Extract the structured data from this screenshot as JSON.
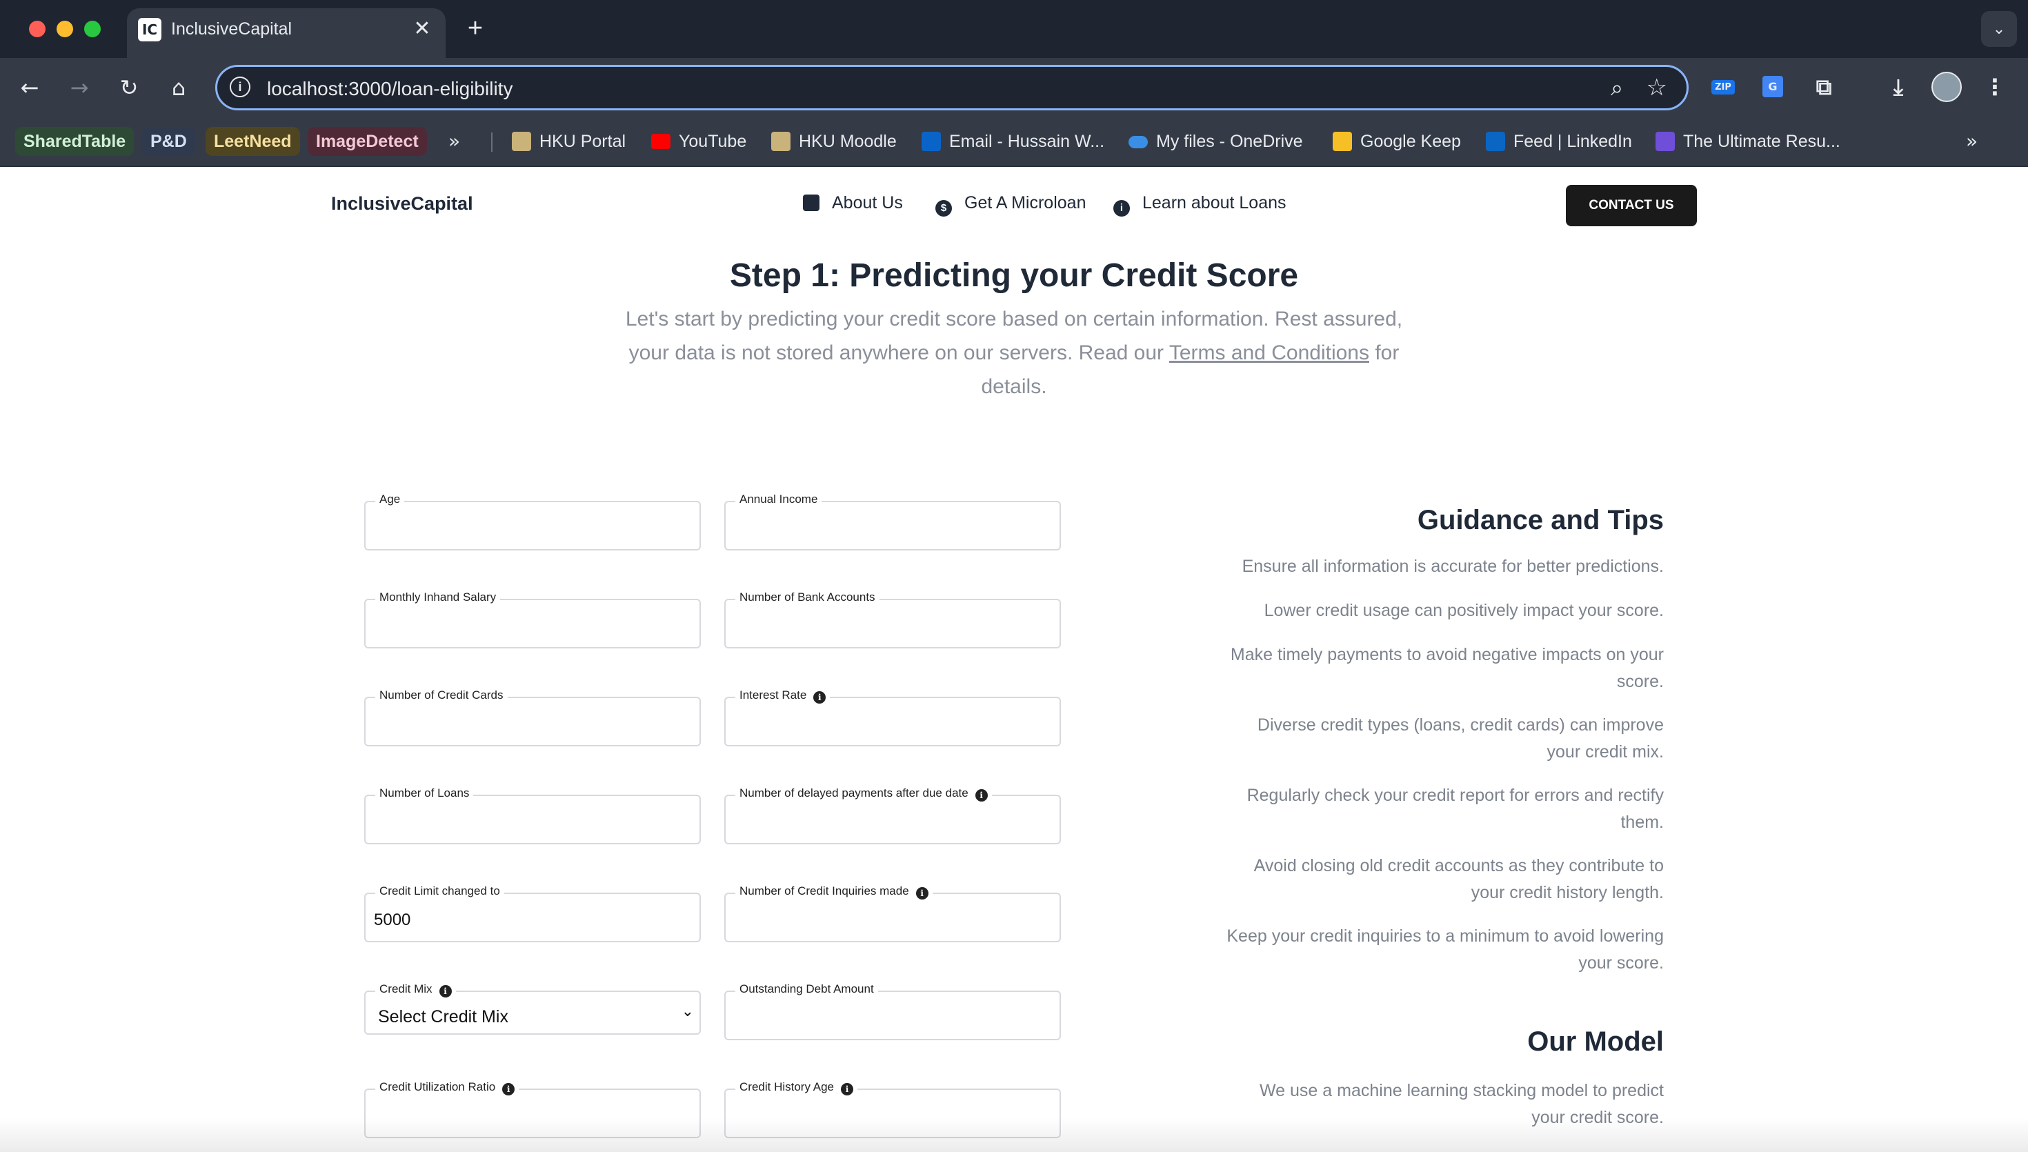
{
  "browser": {
    "tab_title": "InclusiveCapital",
    "tab_favicon": "IC",
    "url": "localhost:3000/loan-eligibility",
    "bookmark_chips": [
      "SharedTable",
      "P&D",
      "LeetNeed",
      "ImageDetect"
    ],
    "bookmarks": [
      "HKU Portal",
      "YouTube",
      "HKU Moodle",
      "Email - Hussain W...",
      "My files - OneDrive",
      "Google Keep",
      "Feed | LinkedIn",
      "The Ultimate Resu..."
    ],
    "extensions": [
      "zip-extension-icon",
      "translate-extension-icon",
      "puzzle-icon",
      "download-icon",
      "avatar",
      "more-icon"
    ]
  },
  "site": {
    "logo": "InclusiveCapital",
    "nav": [
      "About Us",
      "Get A Microloan",
      "Learn about Loans"
    ],
    "contact_button": "CONTACT US"
  },
  "hero": {
    "title": "Step 1: Predicting your Credit Score",
    "subtitle_before": "Let's start by predicting your credit score based on certain information. Rest assured, your data is not stored anywhere on our servers. Read our",
    "subtitle_link": "Terms and Conditions",
    "subtitle_after": "for details."
  },
  "form": {
    "age": {
      "label": "Age",
      "value": ""
    },
    "annual_income": {
      "label": "Annual Income",
      "value": ""
    },
    "monthly_salary": {
      "label": "Monthly Inhand Salary",
      "value": ""
    },
    "bank_accounts": {
      "label": "Number of Bank Accounts",
      "value": ""
    },
    "credit_cards": {
      "label": "Number of Credit Cards",
      "value": ""
    },
    "interest_rate": {
      "label": "Interest Rate",
      "value": ""
    },
    "loans": {
      "label": "Number of Loans",
      "value": ""
    },
    "delayed_payments": {
      "label": "Number of delayed payments after due date",
      "value": ""
    },
    "credit_limit": {
      "label": "Credit Limit changed to",
      "value": "5000"
    },
    "credit_inquiries": {
      "label": "Number of Credit Inquiries made",
      "value": ""
    },
    "credit_mix": {
      "label": "Credit Mix",
      "value": "Select Credit Mix"
    },
    "outstanding_debt": {
      "label": "Outstanding Debt Amount",
      "value": ""
    },
    "utilization_ratio": {
      "label": "Credit Utilization Ratio",
      "value": ""
    },
    "history_age": {
      "label": "Credit History Age",
      "value": ""
    }
  },
  "guidance": {
    "title": "Guidance and Tips",
    "tips": [
      "Ensure all information is accurate for better predictions.",
      "Lower credit usage can positively impact your score.",
      "Make timely payments to avoid negative impacts on your score.",
      "Diverse credit types (loans, credit cards) can improve your credit mix.",
      "Regularly check your credit report for errors and rectify them.",
      "Avoid closing old credit accounts as they contribute to your credit history length.",
      "Keep your credit inquiries to a minimum to avoid lowering your score."
    ]
  },
  "model": {
    "title": "Our Model",
    "text": "We use a machine learning stacking model to predict your credit score."
  }
}
